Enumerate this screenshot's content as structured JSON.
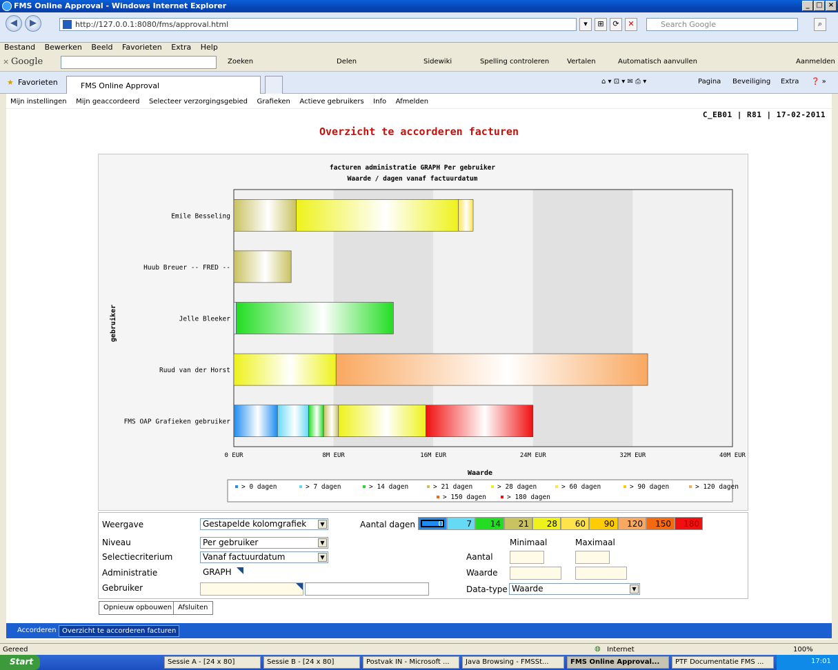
{
  "window": {
    "title": "FMS Online Approval - Windows Internet Explorer"
  },
  "browser": {
    "url": "http://127.0.0.1:8080/fms/approval.html",
    "search_placeholder": "Search Google",
    "menu": [
      "Bestand",
      "Bewerken",
      "Beeld",
      "Favorieten",
      "Extra",
      "Help"
    ],
    "google_toolbar": {
      "logo": "Google",
      "items": [
        "Zoeken",
        "Delen",
        "Sidewiki",
        "Spelling controleren",
        "Vertalen",
        "Automatisch aanvullen",
        "Aanmelden"
      ]
    },
    "favorites_label": "Favorieten",
    "tab_title": "FMS Online Approval",
    "command_bar": [
      "Pagina",
      "Beveiliging",
      "Extra"
    ]
  },
  "app": {
    "menu": [
      "Mijn instellingen",
      "Mijn geaccordeerd",
      "Selecteer verzorgingsgebied",
      "Grafieken",
      "Actieve gebruikers",
      "Info",
      "Afmelden"
    ],
    "session": "C_EB01 | R81 | 17-02-2011",
    "page_title": "Overzicht te accorderen facturen",
    "controls": {
      "weergave_label": "Weergave",
      "weergave_value": "Gestapelde kolomgrafiek",
      "niveau_label": "Niveau",
      "niveau_value": "Per gebruiker",
      "selectie_label": "Selectiecriterium",
      "selectie_value": "Vanaf factuurdatum",
      "administratie_label": "Administratie",
      "administratie_value": "GRAPH",
      "gebruiker_label": "Gebruiker",
      "aantal_dagen_label": "Aantal dagen",
      "days": [
        "0",
        "7",
        "14",
        "21",
        "28",
        "60",
        "90",
        "120",
        "150",
        "180"
      ],
      "minimaal_label": "Minimaal",
      "maximaal_label": "Maximaal",
      "aantal_label": "Aantal",
      "waarde_label": "Waarde",
      "datatype_label": "Data-type",
      "datatype_value": "Waarde"
    },
    "buttons": {
      "rebuild": "Opnieuw opbouwen",
      "close": "Afsluiten"
    },
    "bottom_tabs": [
      "Accorderen",
      "Overzicht te accorderen facturen"
    ]
  },
  "colors": {
    "days": [
      "#1e8cf0",
      "#66d9f5",
      "#22dd22",
      "#c9c261",
      "#eef21a",
      "#ffe34a",
      "#ffcc00",
      "#f9a860",
      "#f36a10",
      "#f01010"
    ]
  },
  "chart_data": {
    "type": "bar",
    "orientation": "horizontal-stacked",
    "title": "facturen administratie GRAPH Per gebruiker",
    "subtitle": "Waarde / dagen  vanaf factuurdatum",
    "xlabel": "Waarde",
    "ylabel": "gebruiker",
    "xlim": [
      0,
      40
    ],
    "x_ticks": [
      "0 EUR",
      "8M EUR",
      "16M EUR",
      "24M EUR",
      "32M EUR",
      "40M EUR"
    ],
    "grid": true,
    "legend_position": "bottom",
    "categories": [
      "Emile Besseling",
      "Huub Breuer -- FRED --",
      "Jelle Bleeker",
      "Ruud van der Horst",
      "FMS OAP Grafieken gebruiker"
    ],
    "series": [
      {
        "name": "> 0 dagen",
        "values": [
          0,
          0,
          0,
          0,
          3.5
        ]
      },
      {
        "name": "> 7 dagen",
        "values": [
          0,
          0,
          0.2,
          0,
          2.5
        ]
      },
      {
        "name": "> 14 dagen",
        "values": [
          0,
          0,
          12.6,
          0,
          1.2
        ]
      },
      {
        "name": "> 21 dagen",
        "values": [
          5.0,
          4.6,
          0,
          0,
          1.2
        ]
      },
      {
        "name": "> 28 dagen",
        "values": [
          13.0,
          0,
          0,
          8.2,
          7.0
        ]
      },
      {
        "name": "> 60 dagen",
        "values": [
          1.2,
          0,
          0,
          0,
          0
        ]
      },
      {
        "name": "> 90 dagen",
        "values": [
          0,
          0,
          0,
          0,
          0
        ]
      },
      {
        "name": "> 120 dagen",
        "values": [
          0,
          0,
          0,
          25.0,
          0
        ]
      },
      {
        "name": "> 150 dagen",
        "values": [
          0,
          0,
          0,
          0,
          0
        ]
      },
      {
        "name": "> 180 dagen",
        "values": [
          0,
          0,
          0,
          0,
          8.6
        ]
      }
    ]
  },
  "status": {
    "left": "Gereed",
    "zone": "Internet",
    "zoom": "100%"
  },
  "taskbar": {
    "start": "Start",
    "items": [
      "Sessie A - [24 x 80]",
      "Sessie B - [24 x 80]",
      "Postvak IN - Microsoft ...",
      "Java Browsing - FMSSt...",
      "FMS Online Approval...",
      "PTF Documentatie FMS ..."
    ],
    "clock": "17:01"
  }
}
